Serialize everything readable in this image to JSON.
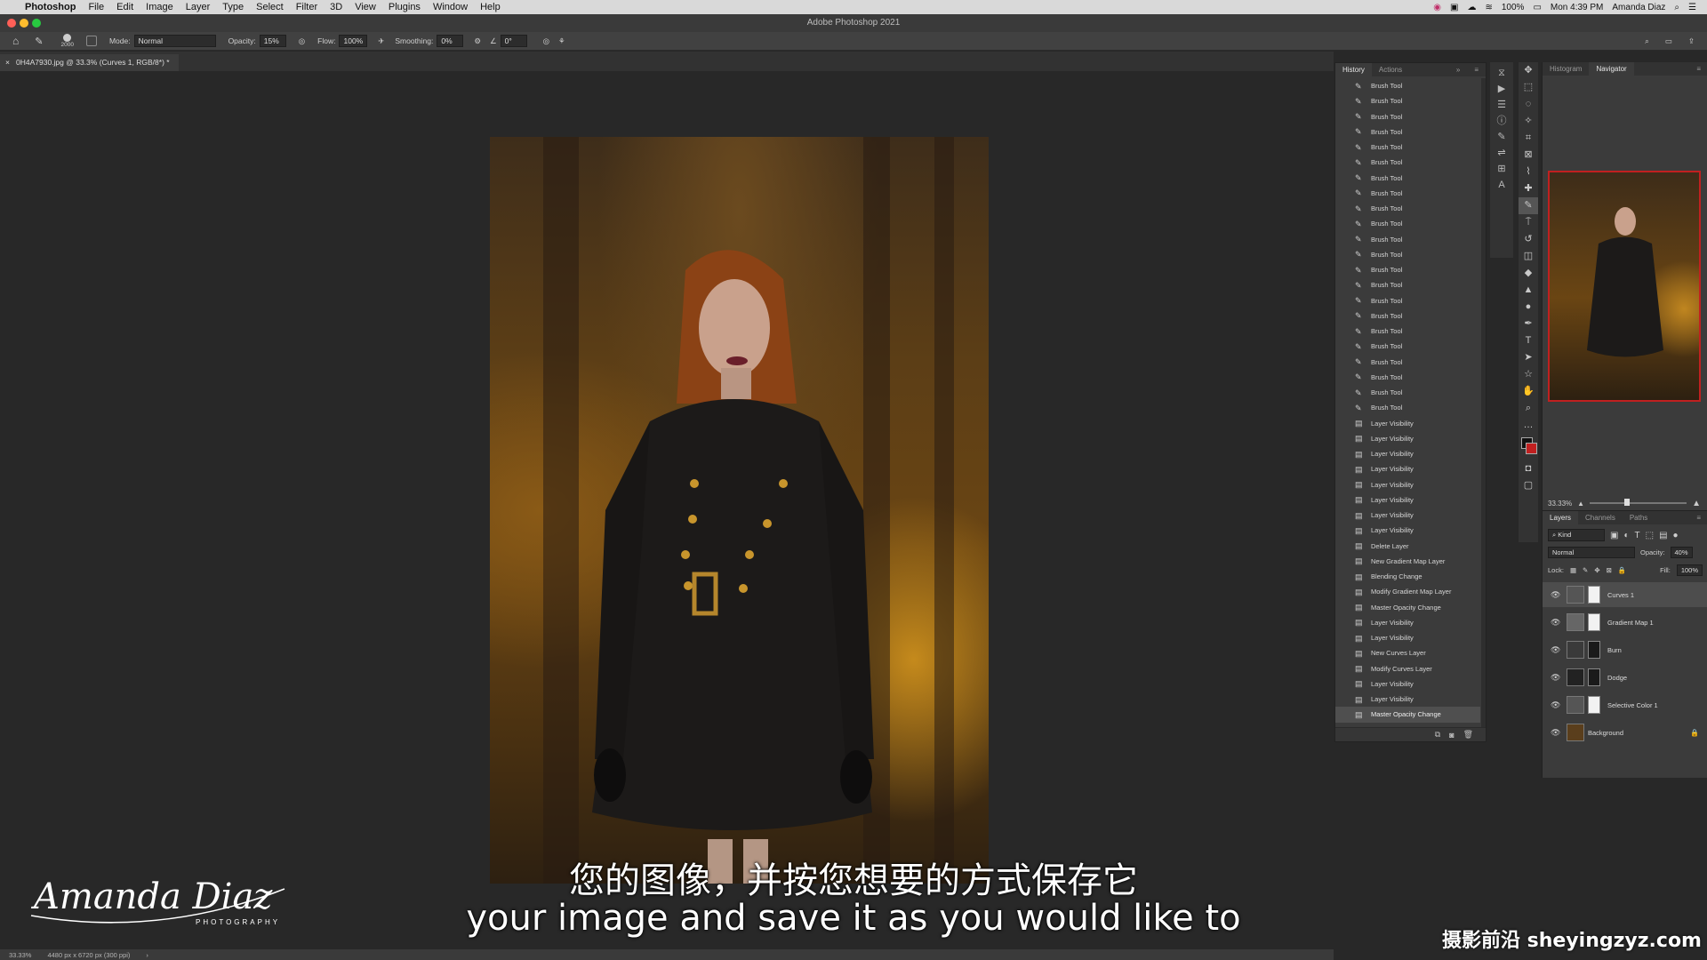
{
  "menubar": {
    "app_name": "Photoshop",
    "items": [
      "File",
      "Edit",
      "Image",
      "Layer",
      "Type",
      "Select",
      "Filter",
      "3D",
      "View",
      "Plugins",
      "Window",
      "Help"
    ],
    "battery": "100%",
    "clock": "Mon 4:39 PM",
    "user": "Amanda Diaz"
  },
  "window": {
    "title": "Adobe Photoshop 2021"
  },
  "options": {
    "brush_size": "2000",
    "mode_label": "Mode:",
    "mode_value": "Normal",
    "opacity_label": "Opacity:",
    "opacity_value": "15%",
    "flow_label": "Flow:",
    "flow_value": "100%",
    "smoothing_label": "Smoothing:",
    "smoothing_value": "0%",
    "angle_value": "0°"
  },
  "document": {
    "tab_title": "0H4A7930.jpg @ 33.3% (Curves 1, RGB/8*) *"
  },
  "status": {
    "zoom": "33.33%",
    "size": "4480 px x 6720 px (300 ppi)"
  },
  "history": {
    "tabs": [
      "History",
      "Actions"
    ],
    "items": [
      "Brush Tool",
      "Brush Tool",
      "Brush Tool",
      "Brush Tool",
      "Brush Tool",
      "Brush Tool",
      "Brush Tool",
      "Brush Tool",
      "Brush Tool",
      "Brush Tool",
      "Brush Tool",
      "Brush Tool",
      "Brush Tool",
      "Brush Tool",
      "Brush Tool",
      "Brush Tool",
      "Brush Tool",
      "Brush Tool",
      "Brush Tool",
      "Brush Tool",
      "Brush Tool",
      "Brush Tool",
      "Layer Visibility",
      "Layer Visibility",
      "Layer Visibility",
      "Layer Visibility",
      "Layer Visibility",
      "Layer Visibility",
      "Layer Visibility",
      "Layer Visibility",
      "Delete Layer",
      "New Gradient Map Layer",
      "Blending Change",
      "Modify Gradient Map Layer",
      "Master Opacity Change",
      "Layer Visibility",
      "Layer Visibility",
      "New Curves Layer",
      "Modify Curves Layer",
      "Layer Visibility",
      "Layer Visibility",
      "Master Opacity Change"
    ],
    "selected_index": 41
  },
  "navigator": {
    "tabs": [
      "Histogram",
      "Navigator"
    ],
    "zoom": "33.33%"
  },
  "layers": {
    "tabs": [
      "Layers",
      "Channels",
      "Paths"
    ],
    "filter_kind": "Kind",
    "blend_mode": "Normal",
    "opacity_label": "Opacity:",
    "opacity_value": "40%",
    "lock_label": "Lock:",
    "fill_label": "Fill:",
    "fill_value": "100%",
    "items": [
      {
        "name": "Curves 1",
        "selected": true
      },
      {
        "name": "Gradient Map 1"
      },
      {
        "name": "Burn"
      },
      {
        "name": "Dodge"
      },
      {
        "name": "Selective Color 1"
      },
      {
        "name": "Background"
      }
    ]
  },
  "subtitles": {
    "chinese": "您的图像，并按您想要的方式保存它",
    "english": "your image and save it as you would like to"
  },
  "watermark": "摄影前沿 sheyingzyz.com",
  "signature": {
    "name": "Amanda Diaz",
    "tagline": "PHOTOGRAPHY"
  },
  "colors": {
    "accent_nav_border": "#c02020",
    "foreground": "#111111",
    "background": "#c02020"
  }
}
